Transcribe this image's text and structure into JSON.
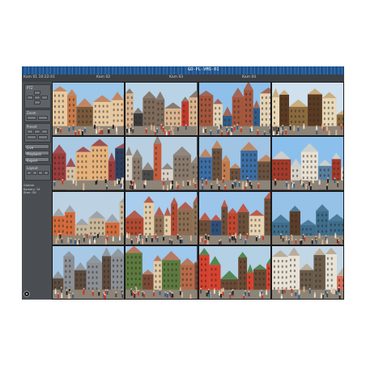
{
  "window": {
    "ticker": "GD-PL-VMS-01"
  },
  "infobar": {
    "items": [
      "Kam 01  10:22:41",
      "Kam 02",
      "Kam 03",
      "Kam 04"
    ]
  },
  "sidebar": {
    "panels": [
      {
        "label": "PTZ"
      },
      {
        "label": "Zoom"
      },
      {
        "label": "Preset"
      },
      {
        "label": "Layout"
      }
    ],
    "buttons": [
      "Live",
      "Playback",
      "Export",
      "Config"
    ],
    "info_text": [
      "Gdańsk",
      "Kamery: 16",
      "Stan: OK"
    ]
  },
  "cameras": [
    {
      "id": "cam-01",
      "scene": "old-town-rooftops"
    },
    {
      "id": "cam-02",
      "scene": "square-red-banner"
    },
    {
      "id": "cam-03",
      "scene": "town-hall-crowd"
    },
    {
      "id": "cam-04",
      "scene": "gate-facade"
    },
    {
      "id": "cam-05",
      "scene": "street-tourists"
    },
    {
      "id": "cam-06",
      "scene": "narrow-street"
    },
    {
      "id": "cam-07",
      "scene": "market-vendor"
    },
    {
      "id": "cam-08",
      "scene": "waterfront-crane"
    },
    {
      "id": "cam-09",
      "scene": "neptune-fountain"
    },
    {
      "id": "cam-10",
      "scene": "long-market-tower"
    },
    {
      "id": "cam-11",
      "scene": "red-roof-square"
    },
    {
      "id": "cam-12",
      "scene": "harbour-ship"
    },
    {
      "id": "cam-13",
      "scene": "tall-houses"
    },
    {
      "id": "cam-14",
      "scene": "armoury-building"
    },
    {
      "id": "cam-15",
      "scene": "umbrella-cafe"
    },
    {
      "id": "cam-16",
      "scene": "crowded-lane"
    }
  ],
  "colors": {
    "topbar": "#2d66a3",
    "panel": "#555a5e",
    "sky": "#8fc3ea"
  }
}
